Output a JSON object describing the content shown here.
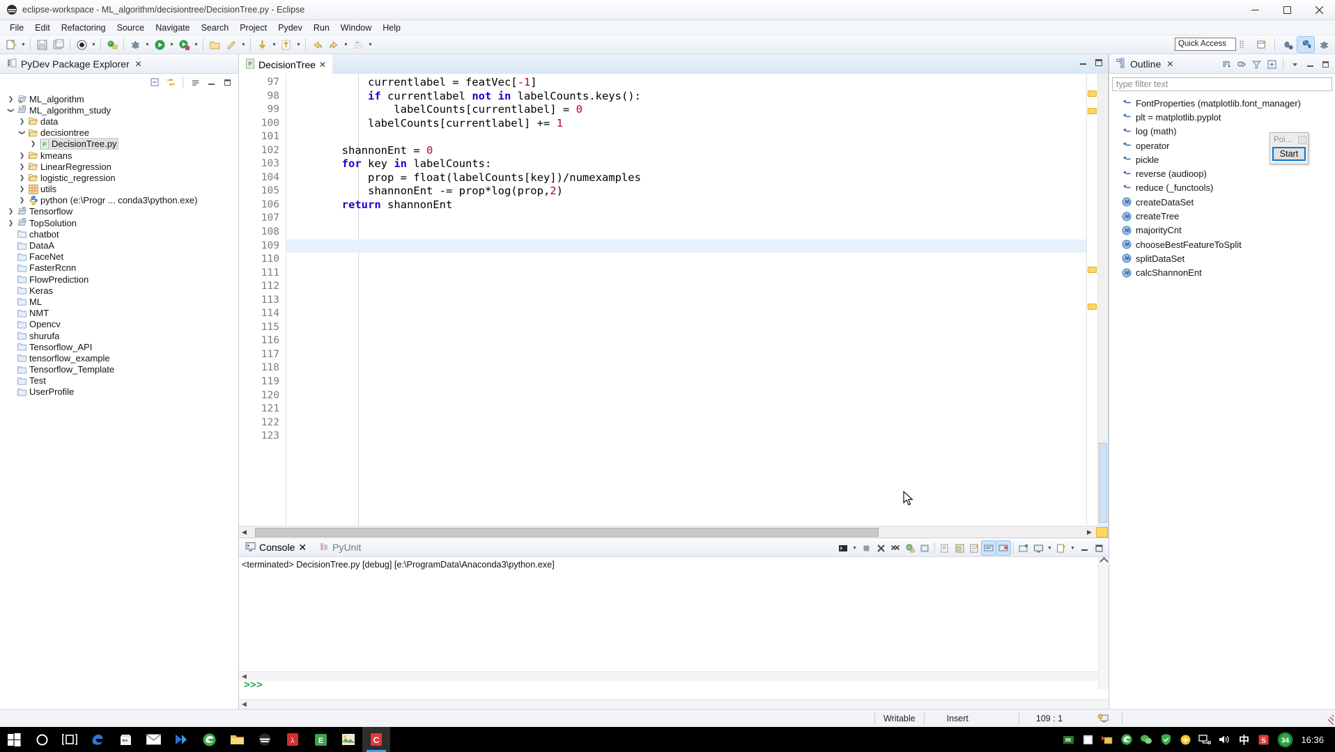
{
  "window": {
    "title": "eclipse-workspace - ML_algorithm/decisiontree/DecisionTree.py - Eclipse",
    "minimize": "–",
    "maximize": "☐",
    "close": "✕"
  },
  "menubar": [
    "File",
    "Edit",
    "Refactoring",
    "Source",
    "Navigate",
    "Search",
    "Project",
    "Pydev",
    "Run",
    "Window",
    "Help"
  ],
  "toolbar": {
    "quick_access_value": "Quick Access",
    "quick_access_placeholder": "Quick Access"
  },
  "package_explorer": {
    "title": "PyDev Package Explorer",
    "close": "✕",
    "tree": [
      {
        "label": "ML_algorithm",
        "depth": 0,
        "twist": "collapsed",
        "icon": "project-warn-icon",
        "selected": false
      },
      {
        "label": "ML_algorithm_study",
        "depth": 0,
        "twist": "expanded",
        "icon": "project-icon",
        "selected": false
      },
      {
        "label": "data",
        "depth": 1,
        "twist": "collapsed",
        "icon": "folder-icon",
        "selected": false
      },
      {
        "label": "decisiontree",
        "depth": 1,
        "twist": "expanded",
        "icon": "folder-icon",
        "selected": false
      },
      {
        "label": "DecisionTree.py",
        "depth": 2,
        "twist": "collapsed",
        "icon": "python-file-icon",
        "selected": true
      },
      {
        "label": "kmeans",
        "depth": 1,
        "twist": "collapsed",
        "icon": "folder-icon",
        "selected": false
      },
      {
        "label": "LinearRegression",
        "depth": 1,
        "twist": "collapsed",
        "icon": "folder-icon",
        "selected": false
      },
      {
        "label": "logistic_regression",
        "depth": 1,
        "twist": "collapsed",
        "icon": "folder-icon",
        "selected": false
      },
      {
        "label": "utils",
        "depth": 1,
        "twist": "collapsed",
        "icon": "grid-icon",
        "selected": false
      },
      {
        "label": "python  (e:\\Progr ... conda3\\python.exe)",
        "depth": 1,
        "twist": "collapsed",
        "icon": "python-interp-icon",
        "selected": false
      },
      {
        "label": "Tensorflow",
        "depth": 0,
        "twist": "collapsed",
        "icon": "project-icon",
        "selected": false
      },
      {
        "label": "TopSolution",
        "depth": 0,
        "twist": "collapsed",
        "icon": "project-icon",
        "selected": false
      },
      {
        "label": "chatbot",
        "depth": 0,
        "twist": "none",
        "icon": "closed-folder-icon",
        "selected": false
      },
      {
        "label": "DataA",
        "depth": 0,
        "twist": "none",
        "icon": "closed-folder-icon",
        "selected": false
      },
      {
        "label": "FaceNet",
        "depth": 0,
        "twist": "none",
        "icon": "closed-folder-icon",
        "selected": false
      },
      {
        "label": "FasterRcnn",
        "depth": 0,
        "twist": "none",
        "icon": "closed-folder-icon",
        "selected": false
      },
      {
        "label": "FlowPrediction",
        "depth": 0,
        "twist": "none",
        "icon": "closed-folder-icon",
        "selected": false
      },
      {
        "label": "Keras",
        "depth": 0,
        "twist": "none",
        "icon": "closed-folder-icon",
        "selected": false
      },
      {
        "label": "ML",
        "depth": 0,
        "twist": "none",
        "icon": "closed-folder-icon",
        "selected": false
      },
      {
        "label": "NMT",
        "depth": 0,
        "twist": "none",
        "icon": "closed-folder-icon",
        "selected": false
      },
      {
        "label": "Opencv",
        "depth": 0,
        "twist": "none",
        "icon": "closed-folder-icon",
        "selected": false
      },
      {
        "label": "shurufa",
        "depth": 0,
        "twist": "none",
        "icon": "closed-folder-icon",
        "selected": false
      },
      {
        "label": "Tensorflow_API",
        "depth": 0,
        "twist": "none",
        "icon": "closed-folder-icon",
        "selected": false
      },
      {
        "label": "tensorflow_example",
        "depth": 0,
        "twist": "none",
        "icon": "closed-folder-icon",
        "selected": false
      },
      {
        "label": "Tensorflow_Template",
        "depth": 0,
        "twist": "none",
        "icon": "closed-folder-icon",
        "selected": false
      },
      {
        "label": "Test",
        "depth": 0,
        "twist": "none",
        "icon": "closed-folder-icon",
        "selected": false
      },
      {
        "label": "UserProfile",
        "depth": 0,
        "twist": "none",
        "icon": "closed-folder-icon",
        "selected": false
      }
    ]
  },
  "editor": {
    "tab_label": "DecisionTree",
    "tab_close": "✕",
    "first_line": 97,
    "cursor_line": 109,
    "lines": [
      {
        "n": 97,
        "segments": [
          {
            "t": "            currentlabel = featVec[",
            "c": "plain"
          },
          {
            "t": "-1",
            "c": "num"
          },
          {
            "t": "]",
            "c": "plain"
          }
        ]
      },
      {
        "n": 98,
        "segments": [
          {
            "t": "            ",
            "c": "plain"
          },
          {
            "t": "if",
            "c": "kw"
          },
          {
            "t": " currentlabel ",
            "c": "plain"
          },
          {
            "t": "not in",
            "c": "kw"
          },
          {
            "t": " labelCounts.keys():",
            "c": "plain"
          }
        ]
      },
      {
        "n": 99,
        "segments": [
          {
            "t": "                labelCounts[currentlabel] = ",
            "c": "plain"
          },
          {
            "t": "0",
            "c": "num"
          }
        ]
      },
      {
        "n": 100,
        "segments": [
          {
            "t": "            labelCounts[currentlabel] += ",
            "c": "plain"
          },
          {
            "t": "1",
            "c": "num"
          }
        ]
      },
      {
        "n": 101,
        "segments": [
          {
            "t": "",
            "c": "plain"
          }
        ]
      },
      {
        "n": 102,
        "segments": [
          {
            "t": "        shannonEnt = ",
            "c": "plain"
          },
          {
            "t": "0",
            "c": "num"
          }
        ]
      },
      {
        "n": 103,
        "segments": [
          {
            "t": "        ",
            "c": "plain"
          },
          {
            "t": "for",
            "c": "kw"
          },
          {
            "t": " key ",
            "c": "plain"
          },
          {
            "t": "in",
            "c": "kw"
          },
          {
            "t": " labelCounts:",
            "c": "plain"
          }
        ]
      },
      {
        "n": 104,
        "segments": [
          {
            "t": "            prop = float(labelCounts[key])/numexamples",
            "c": "plain"
          }
        ]
      },
      {
        "n": 105,
        "segments": [
          {
            "t": "            shannonEnt -= prop*log(prop,",
            "c": "plain"
          },
          {
            "t": "2",
            "c": "num"
          },
          {
            "t": ")",
            "c": "plain"
          }
        ]
      },
      {
        "n": 106,
        "segments": [
          {
            "t": "        ",
            "c": "plain"
          },
          {
            "t": "return",
            "c": "kw"
          },
          {
            "t": " shannonEnt",
            "c": "plain"
          }
        ]
      },
      {
        "n": 107,
        "segments": [
          {
            "t": "",
            "c": "plain"
          }
        ]
      },
      {
        "n": 108,
        "segments": [
          {
            "t": "",
            "c": "plain"
          }
        ]
      },
      {
        "n": 109,
        "segments": [
          {
            "t": "",
            "c": "plain"
          }
        ]
      },
      {
        "n": 110,
        "segments": [
          {
            "t": "",
            "c": "plain"
          }
        ]
      },
      {
        "n": 111,
        "segments": [
          {
            "t": "",
            "c": "plain"
          }
        ]
      },
      {
        "n": 112,
        "segments": [
          {
            "t": "",
            "c": "plain"
          }
        ]
      },
      {
        "n": 113,
        "segments": [
          {
            "t": "",
            "c": "plain"
          }
        ]
      },
      {
        "n": 114,
        "segments": [
          {
            "t": "",
            "c": "plain"
          }
        ]
      },
      {
        "n": 115,
        "segments": [
          {
            "t": "",
            "c": "plain"
          }
        ]
      },
      {
        "n": 116,
        "segments": [
          {
            "t": "",
            "c": "plain"
          }
        ]
      },
      {
        "n": 117,
        "segments": [
          {
            "t": "",
            "c": "plain"
          }
        ]
      },
      {
        "n": 118,
        "segments": [
          {
            "t": "",
            "c": "plain"
          }
        ]
      },
      {
        "n": 119,
        "segments": [
          {
            "t": "",
            "c": "plain"
          }
        ]
      },
      {
        "n": 120,
        "segments": [
          {
            "t": "",
            "c": "plain"
          }
        ]
      },
      {
        "n": 121,
        "segments": [
          {
            "t": "",
            "c": "plain"
          }
        ]
      },
      {
        "n": 122,
        "segments": [
          {
            "t": "",
            "c": "plain"
          }
        ]
      },
      {
        "n": 123,
        "segments": [
          {
            "t": "",
            "c": "plain"
          }
        ]
      }
    ]
  },
  "outline": {
    "title": "Outline",
    "close": "✕",
    "filter_placeholder": "type filter text",
    "items": [
      {
        "label": "FontProperties (matplotlib.font_manager)",
        "icon": "import-icon"
      },
      {
        "label": "plt = matplotlib.pyplot",
        "icon": "import-icon"
      },
      {
        "label": "log (math)",
        "icon": "import-icon"
      },
      {
        "label": "operator",
        "icon": "import-icon"
      },
      {
        "label": "pickle",
        "icon": "import-icon"
      },
      {
        "label": "reverse (audioop)",
        "icon": "import-icon"
      },
      {
        "label": "reduce (_functools)",
        "icon": "import-icon"
      },
      {
        "label": "createDataSet",
        "icon": "method-icon"
      },
      {
        "label": "createTree",
        "icon": "method-icon"
      },
      {
        "label": "majorityCnt",
        "icon": "method-icon"
      },
      {
        "label": "chooseBestFeatureToSplit",
        "icon": "method-icon"
      },
      {
        "label": "splitDataSet",
        "icon": "method-icon"
      },
      {
        "label": "calcShannonEnt",
        "icon": "method-icon"
      }
    ]
  },
  "popup": {
    "title": "Poi...",
    "button": "Start",
    "close": ""
  },
  "console": {
    "tab_label": "Console",
    "tab_close": "✕",
    "secondary_tab": "PyUnit",
    "terminated_line": "<terminated> DecisionTree.py [debug] [e:\\ProgramData\\Anaconda3\\python.exe]",
    "prompt": ">>>"
  },
  "statusbar": {
    "writable": "Writable",
    "insert": "Insert",
    "position": "109 : 1"
  },
  "taskbar": {
    "clock": "16:36",
    "ime": "中",
    "badge": "34",
    "items": [
      {
        "name": "start-button"
      },
      {
        "name": "cortana-search"
      },
      {
        "name": "task-view"
      },
      {
        "name": "edge-browser"
      },
      {
        "name": "microsoft-store"
      },
      {
        "name": "mail-app"
      },
      {
        "name": "kugou-app"
      },
      {
        "name": "360-browser"
      },
      {
        "name": "file-explorer"
      },
      {
        "name": "eclipse-app"
      },
      {
        "name": "pdf-reader"
      },
      {
        "name": "excel-app"
      },
      {
        "name": "photos-app"
      },
      {
        "name": "eclipse-active"
      }
    ]
  },
  "colors": {
    "keyword": "#2000cf",
    "number": "#b00040",
    "accent": "#0078d7",
    "cursor_line": "#e8f2fe",
    "marker": "#ffd75e",
    "prompt_green": "#22b14c"
  }
}
